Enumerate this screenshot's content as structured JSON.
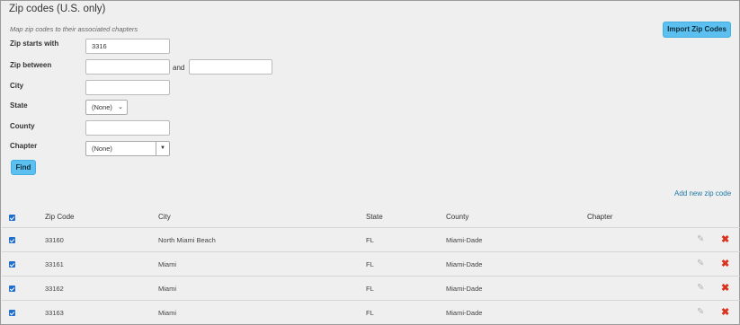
{
  "header": {
    "title": "Zip codes (U.S. only)",
    "subtitle": "Map zip codes to their associated chapters",
    "import_button": "Import Zip Codes"
  },
  "filters": {
    "zip_starts_label": "Zip starts with",
    "zip_starts_value": "3316",
    "zip_between_label": "Zip between",
    "zip_between_and": "and",
    "zip_between_from": "",
    "zip_between_to": "",
    "city_label": "City",
    "city_value": "",
    "state_label": "State",
    "state_value": "(None)",
    "county_label": "County",
    "county_value": "",
    "chapter_label": "Chapter",
    "chapter_value": "(None)",
    "find_button": "Find"
  },
  "add_link": "Add new zip code",
  "table": {
    "headers": [
      "Zip Code",
      "City",
      "State",
      "County",
      "Chapter"
    ],
    "rows": [
      {
        "zip": "33160",
        "city": "North Miami Beach",
        "state": "FL",
        "county": "Miami-Dade",
        "chapter": ""
      },
      {
        "zip": "33161",
        "city": "Miami",
        "state": "FL",
        "county": "Miami-Dade",
        "chapter": ""
      },
      {
        "zip": "33162",
        "city": "Miami",
        "state": "FL",
        "county": "Miami-Dade",
        "chapter": ""
      },
      {
        "zip": "33163",
        "city": "Miami",
        "state": "FL",
        "county": "Miami-Dade",
        "chapter": ""
      }
    ]
  },
  "icons": {
    "edit": "pencil-icon",
    "delete": "delete-x-icon"
  },
  "colors": {
    "accent_button": "#5bc0f0",
    "link": "#1f7aa6",
    "delete": "#d9331f",
    "checkbox": "#1f6fd1"
  }
}
